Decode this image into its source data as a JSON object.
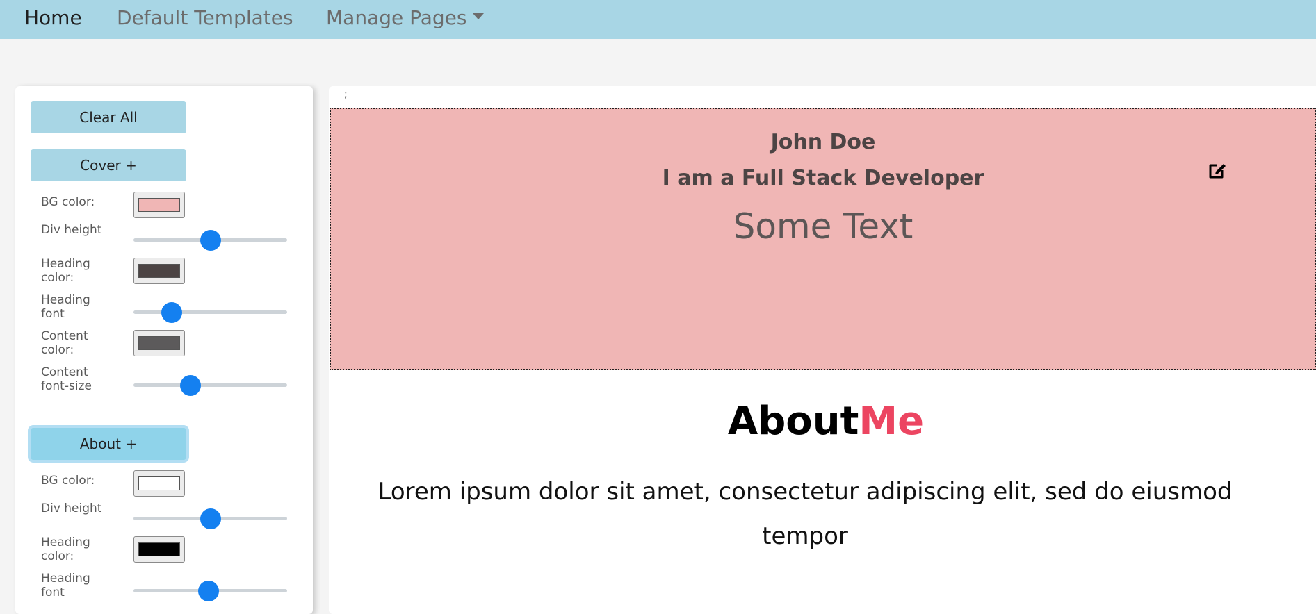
{
  "nav": {
    "home": "Home",
    "templates": "Default Templates",
    "manage": "Manage Pages"
  },
  "sidebar": {
    "clear_all": "Clear All",
    "cover": {
      "button": "Cover +",
      "bg_color_label": "BG color:",
      "bg_color": "#f0b6b5",
      "div_height_label": "Div height",
      "div_height_level": 0.5,
      "heading_color_label": "Heading color:",
      "heading_color": "#4c4444",
      "heading_font_label": "Heading font",
      "heading_font_level": 0.25,
      "content_color_label": "Content color:",
      "content_color": "#5c5a5b",
      "content_font_size_label": "Content font-size",
      "content_font_size_level": 0.37
    },
    "about": {
      "button": "About +",
      "bg_color_label": "BG color:",
      "bg_color": "#ffffff",
      "div_height_label": "Div height",
      "div_height_level": 0.5,
      "heading_color_label": "Heading color:",
      "heading_color": "#000000",
      "heading_font_label": "Heading font",
      "heading_font_level": 0.49
    }
  },
  "main": {
    "separator": ";",
    "cover": {
      "name": "John Doe",
      "role": "I am a Full Stack Developer",
      "text": "Some Text",
      "edit_icon": "edit-icon"
    },
    "about": {
      "title_main": "About",
      "title_accent": "Me",
      "accent_color": "#ec4561",
      "body": "Lorem ipsum dolor sit amet, consectetur adipiscing elit, sed do eiusmod tempor"
    }
  },
  "colors": {
    "navbar": "#a8d6e5",
    "button": "#a8d6e5",
    "slider_thumb": "#1480f0"
  }
}
